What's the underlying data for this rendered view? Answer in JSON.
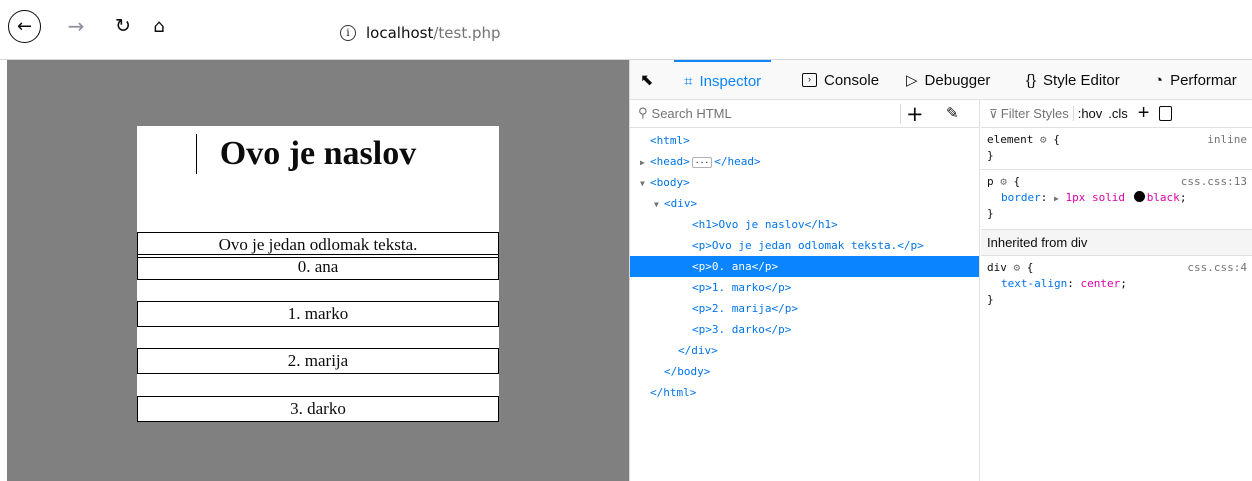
{
  "browser": {
    "url_info_icon": "info-icon",
    "url_host": "localhost",
    "url_path": "/test.php"
  },
  "page": {
    "heading": "Ovo je naslov",
    "paragraphs": [
      "Ovo je jedan odlomak teksta.",
      "0. ana",
      "1. marko",
      "2. marija",
      "3. darko"
    ]
  },
  "devtools": {
    "tabs": [
      {
        "label": "Inspector",
        "icon": "inspector-icon"
      },
      {
        "label": "Console",
        "icon": "console-icon"
      },
      {
        "label": "Debugger",
        "icon": "debugger-icon"
      },
      {
        "label": "Style Editor",
        "icon": "style-editor-icon"
      },
      {
        "label": "Performar",
        "icon": "performance-icon"
      }
    ],
    "search_placeholder": "Search HTML",
    "tree": [
      {
        "indent": 0,
        "text": "<html>"
      },
      {
        "indent": 0,
        "text": "<head>",
        "close": "</head>"
      },
      {
        "indent": 0,
        "text": "<body>"
      },
      {
        "indent": 1,
        "text": "<div>"
      },
      {
        "indent": 2,
        "text": "<h1>Ovo je naslov</h1>"
      },
      {
        "indent": 2,
        "text": "<p>Ovo je jedan odlomak teksta.</p>"
      },
      {
        "indent": 2,
        "text": "<p>0. ana</p>",
        "selected": true
      },
      {
        "indent": 2,
        "text": "<p>1. marko</p>"
      },
      {
        "indent": 2,
        "text": "<p>2. marija</p>"
      },
      {
        "indent": 2,
        "text": "<p>3. darko</p>"
      },
      {
        "indent": 1,
        "text": "</div>"
      },
      {
        "indent": 0,
        "text": "</body>"
      },
      {
        "indent": -1,
        "text": "</html>"
      }
    ],
    "filter_placeholder": "Filter Styles",
    "hov": ":hov",
    "cls": ".cls",
    "rules": {
      "element_selector": "element",
      "element_source": "inline",
      "p_selector": "p",
      "p_source": "css.css:13",
      "p_prop": "border",
      "p_val_a": "1px solid",
      "p_val_b": "black",
      "inherited": "Inherited from div",
      "div_selector": "div",
      "div_source": "css.css:4",
      "div_prop": "text-align",
      "div_val": "center"
    }
  },
  "colors": {
    "accent": "#0a84ff",
    "viewport_bg": "#808080"
  }
}
